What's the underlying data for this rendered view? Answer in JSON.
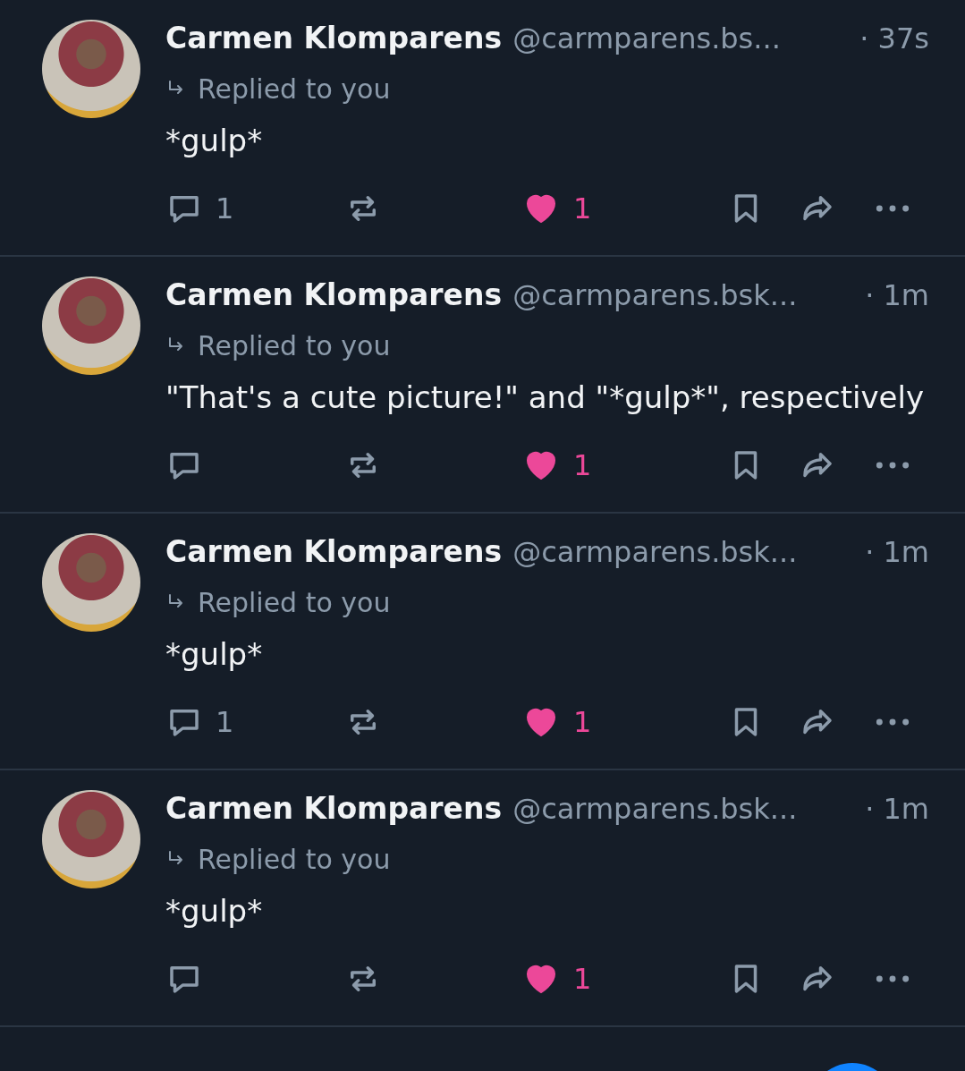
{
  "posts": [
    {
      "author": "Carmen Klomparens",
      "handle": "@carmparens.bs...",
      "time": "· 37s",
      "reply_label": "Replied to you",
      "text": "*gulp*",
      "reply_count": "1",
      "like_count": "1",
      "liked": true
    },
    {
      "author": "Carmen Klomparens",
      "handle": "@carmparens.bsk...",
      "time": "· 1m",
      "reply_label": "Replied to you",
      "text": "\"That's a cute picture!\" and \"*gulp*\", respectively",
      "like_count": "1",
      "liked": true
    },
    {
      "author": "Carmen Klomparens",
      "handle": "@carmparens.bsk...",
      "time": "· 1m",
      "reply_label": "Replied to you",
      "text": "*gulp*",
      "reply_count": "1",
      "like_count": "1",
      "liked": true
    },
    {
      "author": "Carmen Klomparens",
      "handle": "@carmparens.bsk...",
      "time": "· 1m",
      "reply_label": "Replied to you",
      "text": "*gulp*",
      "like_count": "1",
      "liked": true
    }
  ]
}
